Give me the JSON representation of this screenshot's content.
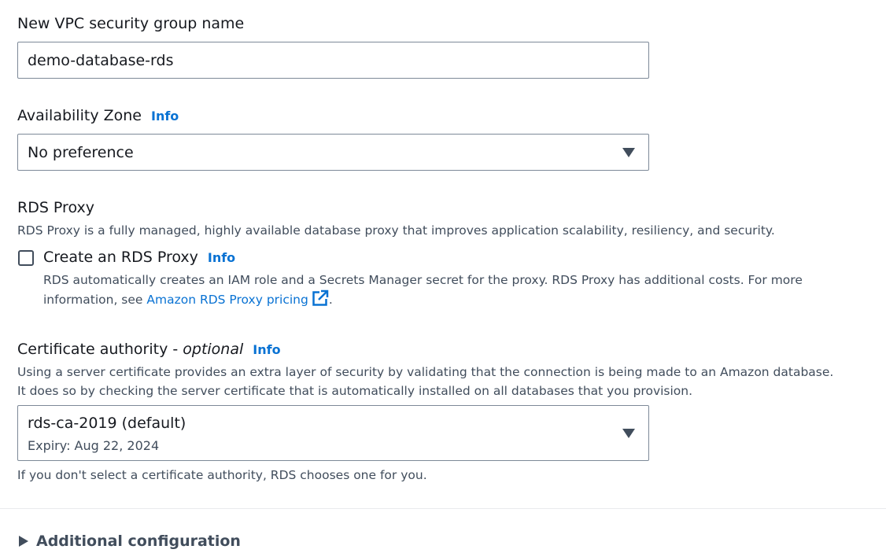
{
  "security_group": {
    "label": "New VPC security group name",
    "value": "demo-database-rds"
  },
  "availability_zone": {
    "label": "Availability Zone",
    "info": "Info",
    "value": "No preference"
  },
  "rds_proxy": {
    "heading": "RDS Proxy",
    "description": "RDS Proxy is a fully managed, highly available database proxy that improves application scalability, resiliency, and security.",
    "checkbox_label": "Create an RDS Proxy",
    "info": "Info",
    "checked": false,
    "detail_text": "RDS automatically creates an IAM role and a Secrets Manager secret for the proxy. RDS Proxy has additional costs. For more information, see ",
    "link_text": "Amazon RDS Proxy pricing",
    "trailing": "."
  },
  "certificate_authority": {
    "label": "Certificate authority",
    "separator": " - ",
    "optional": "optional",
    "info": "Info",
    "description_line1": "Using a server certificate provides an extra layer of security by validating that the connection is being made to an Amazon database.",
    "description_line2": "It does so by checking the server certificate that is automatically installed on all databases that you provision.",
    "value": "rds-ca-2019 (default)",
    "expiry": "Expiry: Aug 22, 2024",
    "help": "If you don't select a certificate authority, RDS chooses one for you."
  },
  "additional_configuration": {
    "label": "Additional configuration"
  },
  "icons": {
    "external_link": "external-link-icon",
    "dropdown": "caret-down-icon",
    "expand": "caret-right-icon"
  },
  "colors": {
    "link": "#0972d3",
    "text": "#16191f",
    "secondary_text": "#414d5c",
    "border": "#7d8998"
  }
}
